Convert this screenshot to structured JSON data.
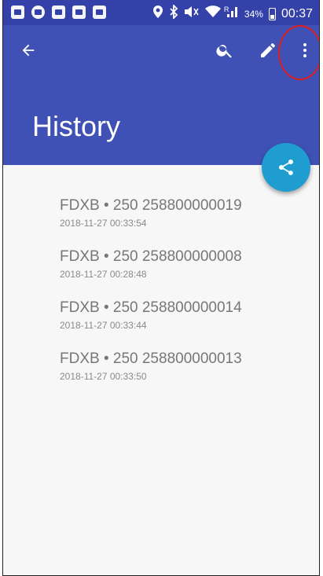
{
  "status_bar": {
    "battery": "34%",
    "time": "00:37",
    "signal_label": "R"
  },
  "toolbar": {
    "title": "History",
    "icons": [
      "arrow-back-icon",
      "search-icon",
      "edit-icon",
      "more-vert-icon",
      "share-icon"
    ]
  },
  "history": {
    "items": [
      {
        "title": "FDXB • 250 258800000019",
        "timestamp": "2018-11-27 00:33:54"
      },
      {
        "title": "FDXB • 250 258800000008",
        "timestamp": "2018-11-27 00:28:48"
      },
      {
        "title": "FDXB • 250 258800000014",
        "timestamp": "2018-11-27 00:33:44"
      },
      {
        "title": "FDXB • 250 258800000013",
        "timestamp": "2018-11-27 00:33:50"
      }
    ]
  },
  "colors": {
    "primary": "#3f51b5",
    "status_bar": "#3341a8",
    "accent": "#1f9dd0",
    "highlight": "#e0201e"
  }
}
